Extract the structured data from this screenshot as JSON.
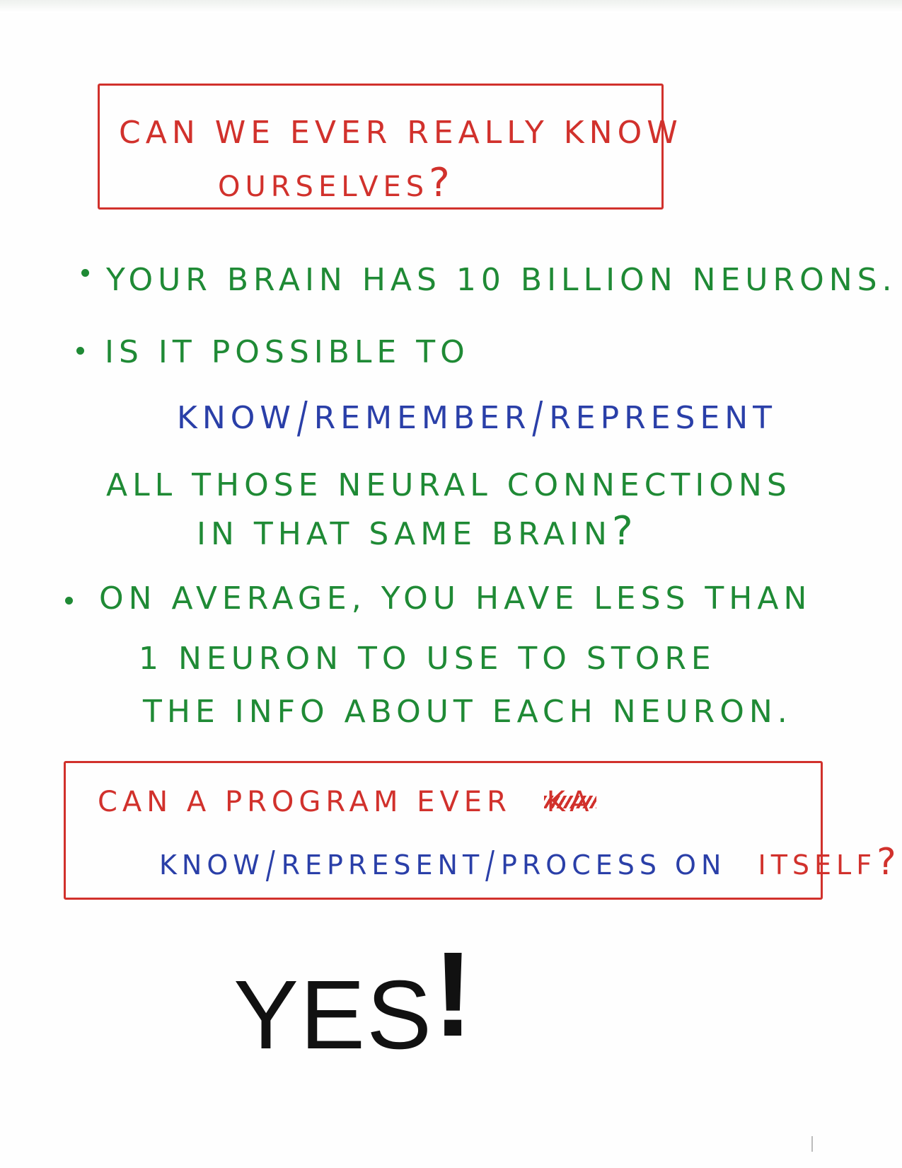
{
  "top_box": {
    "line1": "CAN WE EVER REALLY KNOW",
    "line2": "OURSELVES",
    "qmark": "?"
  },
  "bullet1": "YOUR BRAIN HAS 10 BILLION NEURONS.",
  "bullet2": {
    "line1": "IS IT POSSIBLE TO",
    "know": "KNOW",
    "remember": "REMEMBER",
    "represent": "REPRESENT",
    "line3": "ALL THOSE NEURAL CONNECTIONS",
    "line4": "IN THAT SAME BRAIN",
    "qmark": "?"
  },
  "bullet3": {
    "line1": "ON AVERAGE, YOU HAVE LESS THAN",
    "line2": "1 NEURON TO USE TO STORE",
    "line3": "THE INFO ABOUT EACH NEURON."
  },
  "bottom_box": {
    "line1": "CAN A PROGRAM EVER",
    "crossed_out": "KA",
    "know": "KNOW",
    "represent": "REPRESENT",
    "process_on": "PROCESS ON",
    "itself": "ITSELF",
    "qmark": "?"
  },
  "answer": {
    "word": "YES",
    "exclaim": "!"
  },
  "colors": {
    "green": "#1f8a35",
    "red": "#d1312c",
    "blue": "#2a3fa8",
    "black": "#111111"
  }
}
